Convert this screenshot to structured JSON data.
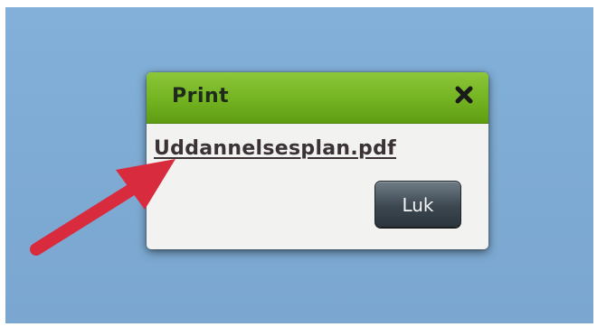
{
  "dialog": {
    "title": "Print",
    "close_icon": "close-x-icon",
    "file_link": "Uddannelsesplan.pdf",
    "close_button_label": "Luk"
  },
  "colors": {
    "background": "#7fabd3",
    "header_green": "#73b321",
    "dialog_body": "#f2f2f1",
    "button_dark": "#3c4750",
    "arrow_red": "#d92b3e"
  },
  "annotation": {
    "icon": "red-arrow-icon"
  }
}
